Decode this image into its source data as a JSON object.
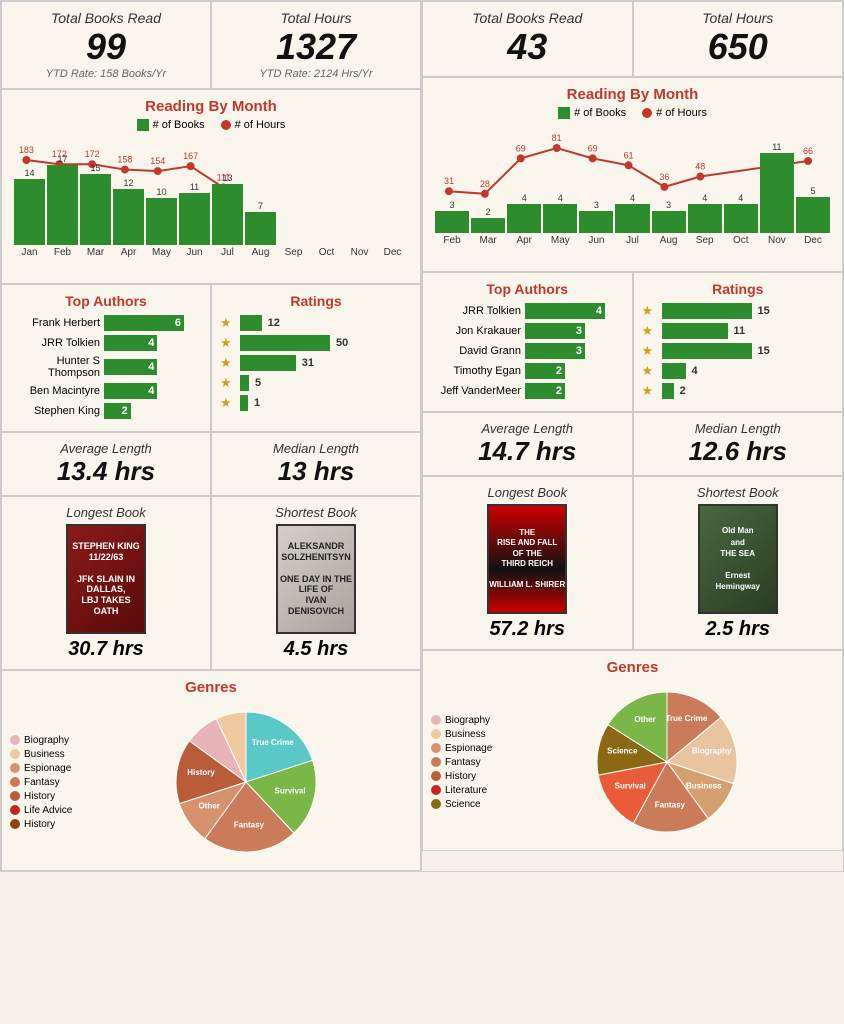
{
  "left": {
    "stats": {
      "total_books_label": "Total Books Read",
      "total_books_value": "99",
      "total_books_ytd": "YTD Rate: 158 Books/Yr",
      "total_hours_label": "Total Hours",
      "total_hours_value": "1327",
      "total_hours_ytd": "YTD Rate: 2124 Hrs/Yr"
    },
    "chart": {
      "title": "Reading By Month",
      "legend_books": "# of Books",
      "legend_hours": "# of Hours",
      "months": [
        "Jan",
        "Feb",
        "Mar",
        "Apr",
        "May",
        "Jun",
        "Jul",
        "Aug",
        "Sep",
        "Oct",
        "Nov",
        "Dec"
      ],
      "books": [
        14,
        17,
        15,
        12,
        10,
        11,
        13,
        7,
        0,
        0,
        0,
        0
      ],
      "hours": [
        183,
        172,
        172,
        158,
        154,
        167,
        111,
        0,
        0,
        0,
        0,
        0
      ]
    },
    "authors": {
      "title": "Top Authors",
      "items": [
        {
          "name": "Frank Herbert",
          "count": 6
        },
        {
          "name": "JRR Tolkien",
          "count": 4
        },
        {
          "name": "Hunter S Thompson",
          "count": 4
        },
        {
          "name": "Ben Macintyre",
          "count": 4
        },
        {
          "name": "Stephen King",
          "count": 2
        }
      ]
    },
    "ratings": {
      "title": "Ratings",
      "items": [
        {
          "stars": 5,
          "count": 12
        },
        {
          "stars": 4,
          "count": 50
        },
        {
          "stars": 3,
          "count": 31
        },
        {
          "stars": 2,
          "count": 5
        },
        {
          "stars": 1,
          "count": 1
        }
      ]
    },
    "lengths": {
      "avg_label": "Average Length",
      "avg_value": "13.4 hrs",
      "med_label": "Median Length",
      "med_value": "13 hrs"
    },
    "books": {
      "longest_label": "Longest Book",
      "longest_title": "11/22/63",
      "longest_author": "STEPHEN KING",
      "longest_hours": "30.7 hrs",
      "shortest_label": "Shortest Book",
      "shortest_title": "One Day in the Life of Ivan Denisovich",
      "shortest_author": "SOLZHENITSYN",
      "shortest_hours": "4.5 hrs"
    },
    "genres": {
      "title": "Genres",
      "items": [
        {
          "label": "Biography",
          "color": "#e8b4b8"
        },
        {
          "label": "Business",
          "color": "#f0c9a0"
        },
        {
          "label": "Espionage",
          "color": "#d4936e"
        },
        {
          "label": "Fantasy",
          "color": "#c97b5a"
        },
        {
          "label": "History",
          "color": "#b85c3a"
        },
        {
          "label": "Life Advice",
          "color": "#cc2222"
        },
        {
          "label": "History",
          "color": "#8b4513"
        }
      ],
      "segments": [
        {
          "label": "True Crime",
          "color": "#5bc8c8",
          "pct": 20
        },
        {
          "label": "Survival",
          "color": "#7ab648",
          "pct": 18
        },
        {
          "label": "Fantasy",
          "color": "#c97b5a",
          "pct": 22
        },
        {
          "label": "Other",
          "color": "#d4936e",
          "pct": 10
        },
        {
          "label": "History",
          "color": "#b85c3a",
          "pct": 15
        },
        {
          "label": "Biography",
          "color": "#e8b4b8",
          "pct": 8
        },
        {
          "label": "Business",
          "color": "#f0c9a0",
          "pct": 7
        }
      ]
    }
  },
  "right": {
    "stats": {
      "total_books_label": "Total Books Read",
      "total_books_value": "43",
      "total_hours_label": "Total Hours",
      "total_hours_value": "650"
    },
    "chart": {
      "title": "Reading By Month",
      "legend_books": "# of Books",
      "legend_hours": "# of Hours",
      "months": [
        "Feb",
        "Mar",
        "Apr",
        "May",
        "Jun",
        "Jul",
        "Aug",
        "Sep",
        "Oct",
        "Nov",
        "Dec"
      ],
      "books": [
        3,
        2,
        4,
        4,
        3,
        4,
        3,
        4,
        4,
        11,
        5
      ],
      "hours": [
        31,
        28,
        69,
        81,
        69,
        61,
        36,
        48,
        0,
        0,
        66
      ]
    },
    "authors": {
      "title": "Top Authors",
      "items": [
        {
          "name": "JRR Tolkien",
          "count": 4
        },
        {
          "name": "Jon Krakauer",
          "count": 3
        },
        {
          "name": "David Grann",
          "count": 3
        },
        {
          "name": "Timothy Egan",
          "count": 2
        },
        {
          "name": "Jeff VanderMeer",
          "count": 2
        }
      ]
    },
    "ratings": {
      "title": "Ratings",
      "items": [
        {
          "stars": 5,
          "count": 15
        },
        {
          "stars": 4,
          "count": 11
        },
        {
          "stars": 3,
          "count": 15
        },
        {
          "stars": 2,
          "count": 4
        },
        {
          "stars": 1,
          "count": 2
        }
      ]
    },
    "lengths": {
      "avg_label": "Average Length",
      "avg_value": "14.7 hrs",
      "med_label": "Median Length",
      "med_value": "12.6 hrs"
    },
    "books": {
      "longest_label": "Longest Book",
      "longest_title": "The Rise and Fall of the Third Reich",
      "longest_hours": "57.2 hrs",
      "shortest_label": "Shortest Book",
      "shortest_title": "The Old Man and the Sea",
      "shortest_author": "Ernest Hemingway",
      "shortest_hours": "2.5 hrs"
    },
    "genres": {
      "title": "Genres",
      "items": [
        {
          "label": "Biography",
          "color": "#e8b4b8"
        },
        {
          "label": "Business",
          "color": "#f0c9a0"
        },
        {
          "label": "Espionage",
          "color": "#d4936e"
        },
        {
          "label": "Fantasy",
          "color": "#c97b5a"
        },
        {
          "label": "History",
          "color": "#b85c3a"
        },
        {
          "label": "Literature",
          "color": "#cc2222"
        },
        {
          "label": "Science",
          "color": "#8b6914"
        }
      ],
      "segments": [
        {
          "label": "True Crime",
          "color": "#c97b5a",
          "pct": 14
        },
        {
          "label": "Biography",
          "color": "#e8c4a0",
          "pct": 16
        },
        {
          "label": "Business",
          "color": "#d4a070",
          "pct": 10
        },
        {
          "label": "Fantasy",
          "color": "#c97b5a",
          "pct": 18
        },
        {
          "label": "Survival",
          "color": "#e85c3a",
          "pct": 14
        },
        {
          "label": "Science",
          "color": "#8b6914",
          "pct": 12
        },
        {
          "label": "Other",
          "color": "#7ab648",
          "pct": 16
        }
      ]
    }
  }
}
